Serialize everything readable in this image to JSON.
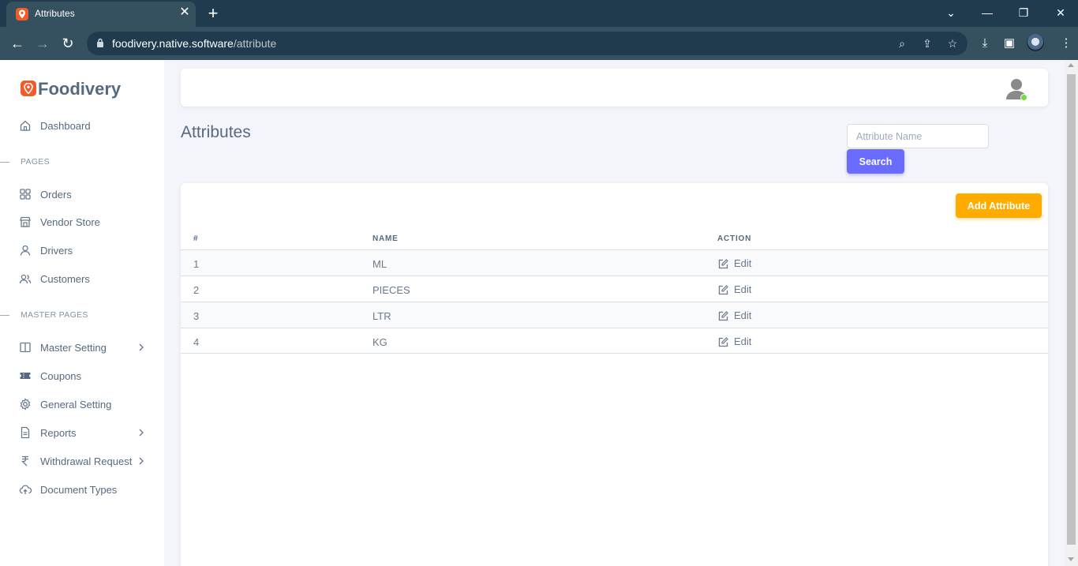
{
  "browser": {
    "tab_title": "Attributes",
    "url_host": "foodivery.native.software",
    "url_path": "/attribute"
  },
  "sidebar": {
    "brand": "Foodivery",
    "dashboard": "Dashboard",
    "section_pages": "PAGES",
    "pages": [
      "Orders",
      "Vendor Store",
      "Drivers",
      "Customers"
    ],
    "section_master": "MASTER PAGES",
    "master": [
      "Master Setting",
      "Coupons",
      "General Setting",
      "Reports",
      "Withdrawal Request",
      "Document Types"
    ]
  },
  "main": {
    "title": "Attributes",
    "search_placeholder": "Attribute Name",
    "search_label": "Search",
    "add_label": "Add Attribute",
    "columns": [
      "#",
      "NAME",
      "ACTION"
    ],
    "rows": [
      {
        "num": "1",
        "name": "ML",
        "action": "Edit"
      },
      {
        "num": "2",
        "name": "PIECES",
        "action": "Edit"
      },
      {
        "num": "3",
        "name": "LTR",
        "action": "Edit"
      },
      {
        "num": "4",
        "name": "KG",
        "action": "Edit"
      }
    ]
  },
  "colors": {
    "primary": "#696cff",
    "warning": "#ffab00",
    "brand": "#f15a29",
    "online": "#71dd37"
  }
}
